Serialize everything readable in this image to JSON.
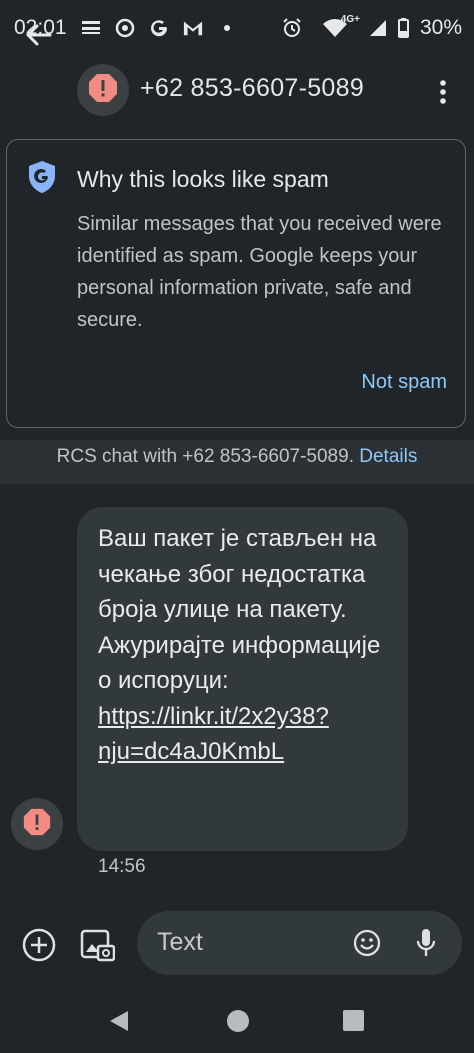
{
  "status_bar": {
    "time": "02:01",
    "battery": "30%",
    "network": "4G+",
    "icons": [
      "notification-icon",
      "target-icon",
      "google-icon",
      "gmail-icon",
      "dot-icon",
      "alarm-icon",
      "wifi-icon",
      "signal-icon",
      "battery-icon"
    ]
  },
  "app_bar": {
    "title": "+62 853-6607-5089",
    "icons": [
      "back-arrow-icon",
      "spam-warning-icon",
      "overflow-menu-icon"
    ]
  },
  "spam_card": {
    "title": "Why this looks like spam",
    "body": "Similar messages that you received were identified as spam. Google keeps your personal information private, safe and secure.",
    "action": "Not spam",
    "icon": "google-shield-icon"
  },
  "rcs_banner": {
    "text": "RCS chat with +62 853-6607-5089.",
    "link": "Details"
  },
  "message": {
    "text": "Ваш пакет је стављен на чекање због недостатка броја улице на пакету. Ажурирајте информације о испоруци: ",
    "link": "https://linkr.it/2x2y38?nju=dc4aJ0KmbL",
    "time": "14:56"
  },
  "composer": {
    "placeholder": "Text",
    "icons": [
      "add-icon",
      "gallery-icon",
      "emoji-icon",
      "mic-icon"
    ]
  },
  "colors": {
    "background": "#1f2528",
    "bubble": "#31393c",
    "link": "#8ec8f8",
    "warning": "#f28b82"
  }
}
